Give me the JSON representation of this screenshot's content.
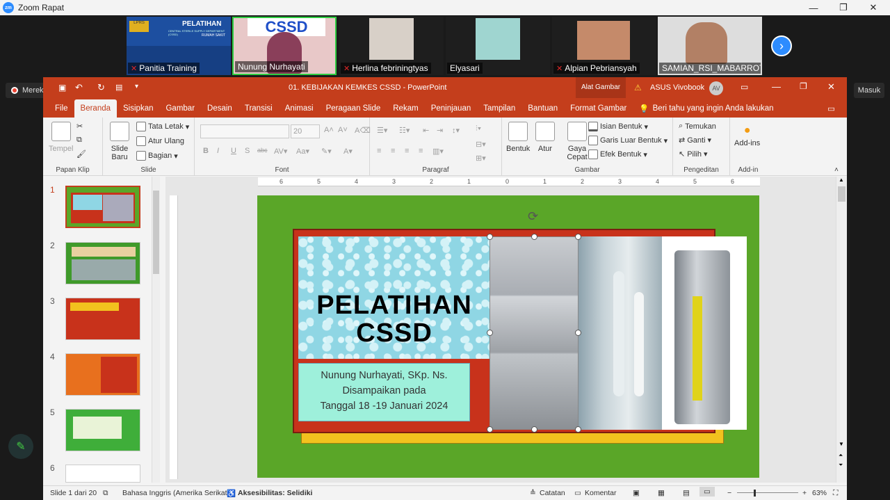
{
  "zoom": {
    "window_title": "Zoom Rapat",
    "logo": "zm",
    "recording_label": "Merekam...",
    "join_label": "Masuk",
    "participants": [
      {
        "name": "Panitia Training",
        "muted": true
      },
      {
        "name": "Nunung Nurhayati",
        "muted": false
      },
      {
        "name": "Herlina febriningtyas",
        "muted": true
      },
      {
        "name": "Elyasari",
        "muted": false
      },
      {
        "name": "Alpian Pebriansyah",
        "muted": true
      },
      {
        "name": "SAMIAN_RSI_MABARROT...",
        "muted": false
      }
    ],
    "tile1_banner": {
      "title": "PELATIHAN",
      "line2": "CENTRAL STERILE SUPPLY DEPARTMENT (CSSD)",
      "line3": "RUMAH SAKIT"
    },
    "tile2_banner": "CSSD"
  },
  "ppt": {
    "doc_title": "01. KEBIJAKAN KEMKES CSSD  -  PowerPoint",
    "context_tab": "Alat Gambar",
    "account": "ASUS Vivobook",
    "account_initials": "AV",
    "tabs": [
      "File",
      "Beranda",
      "Sisipkan",
      "Gambar",
      "Desain",
      "Transisi",
      "Animasi",
      "Peragaan Slide",
      "Rekam",
      "Peninjauan",
      "Tampilan",
      "Bantuan",
      "Format Gambar"
    ],
    "active_tab": "Beranda",
    "tell_me": "Beri tahu yang ingin Anda lakukan",
    "ribbon": {
      "clipboard": {
        "paste": "Tempel",
        "label": "Papan Klip"
      },
      "slide": {
        "new": "Slide Baru",
        "layout": "Tata Letak",
        "reset": "Atur Ulang",
        "section": "Bagian",
        "label": "Slide"
      },
      "font": {
        "size": "20",
        "label": "Font"
      },
      "paragraph": {
        "label": "Paragraf"
      },
      "drawing": {
        "shapes": "Bentuk",
        "arrange": "Atur",
        "quick_styles": "Gaya Cepat",
        "fill": "Isian Bentuk",
        "outline": "Garis Luar Bentuk",
        "effects": "Efek Bentuk",
        "label": "Gambar"
      },
      "editing": {
        "find": "Temukan",
        "replace": "Ganti",
        "select": "Pilih",
        "label": "Pengeditan"
      },
      "addins": {
        "button": "Add-ins",
        "label": "Add-in"
      }
    },
    "ruler_numbers": [
      "6",
      "5",
      "4",
      "3",
      "2",
      "1",
      "0",
      "1",
      "2",
      "3",
      "4",
      "5",
      "6"
    ],
    "thumbnails": [
      {
        "num": "1",
        "selected": true
      },
      {
        "num": "2",
        "selected": false
      },
      {
        "num": "3",
        "selected": false
      },
      {
        "num": "4",
        "selected": false
      },
      {
        "num": "5",
        "selected": false
      },
      {
        "num": "6",
        "selected": false
      }
    ],
    "slide": {
      "title_line1": "PELATIHAN",
      "title_line2": "CSSD",
      "presenter": "Nunung Nurhayati, SKp. Ns.",
      "delivered": "Disampaikan pada",
      "date": "Tanggal 18 -19 Januari 2024"
    },
    "status": {
      "slide_count": "Slide 1 dari 20",
      "language": "Bahasa Inggris (Amerika Serikat)",
      "accessibility": "Aksesibilitas: Selidiki",
      "notes": "Catatan",
      "comments": "Komentar",
      "zoom": "63%"
    }
  }
}
